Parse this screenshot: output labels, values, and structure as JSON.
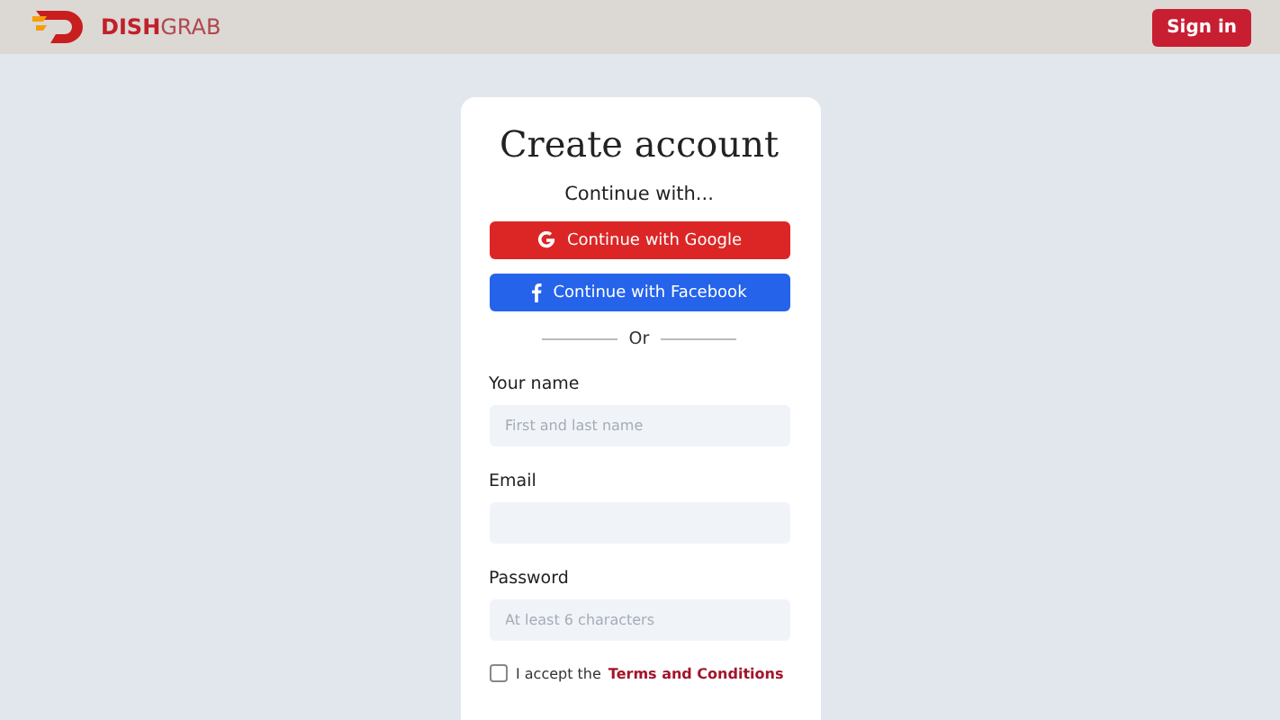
{
  "header": {
    "brand": "**DISH**GRAB",
    "sign_in": "Sign in"
  },
  "card": {
    "title": "Create account",
    "subtitle": "Continue with...",
    "social_buttons": [
      {
        "kind": "google",
        "label": "Continue with Google"
      },
      {
        "kind": "facebook",
        "label": "Continue with Facebook"
      }
    ],
    "divider": "Or",
    "fields": [
      {
        "label": "Your name",
        "placeholder": "First and last name"
      },
      {
        "label": "Email"
      },
      {
        "label": "Password",
        "placeholder": "At least 6 characters"
      }
    ],
    "terms": {
      "checked": false,
      "text": "I accept the",
      "link": "Terms and Conditions"
    }
  }
}
